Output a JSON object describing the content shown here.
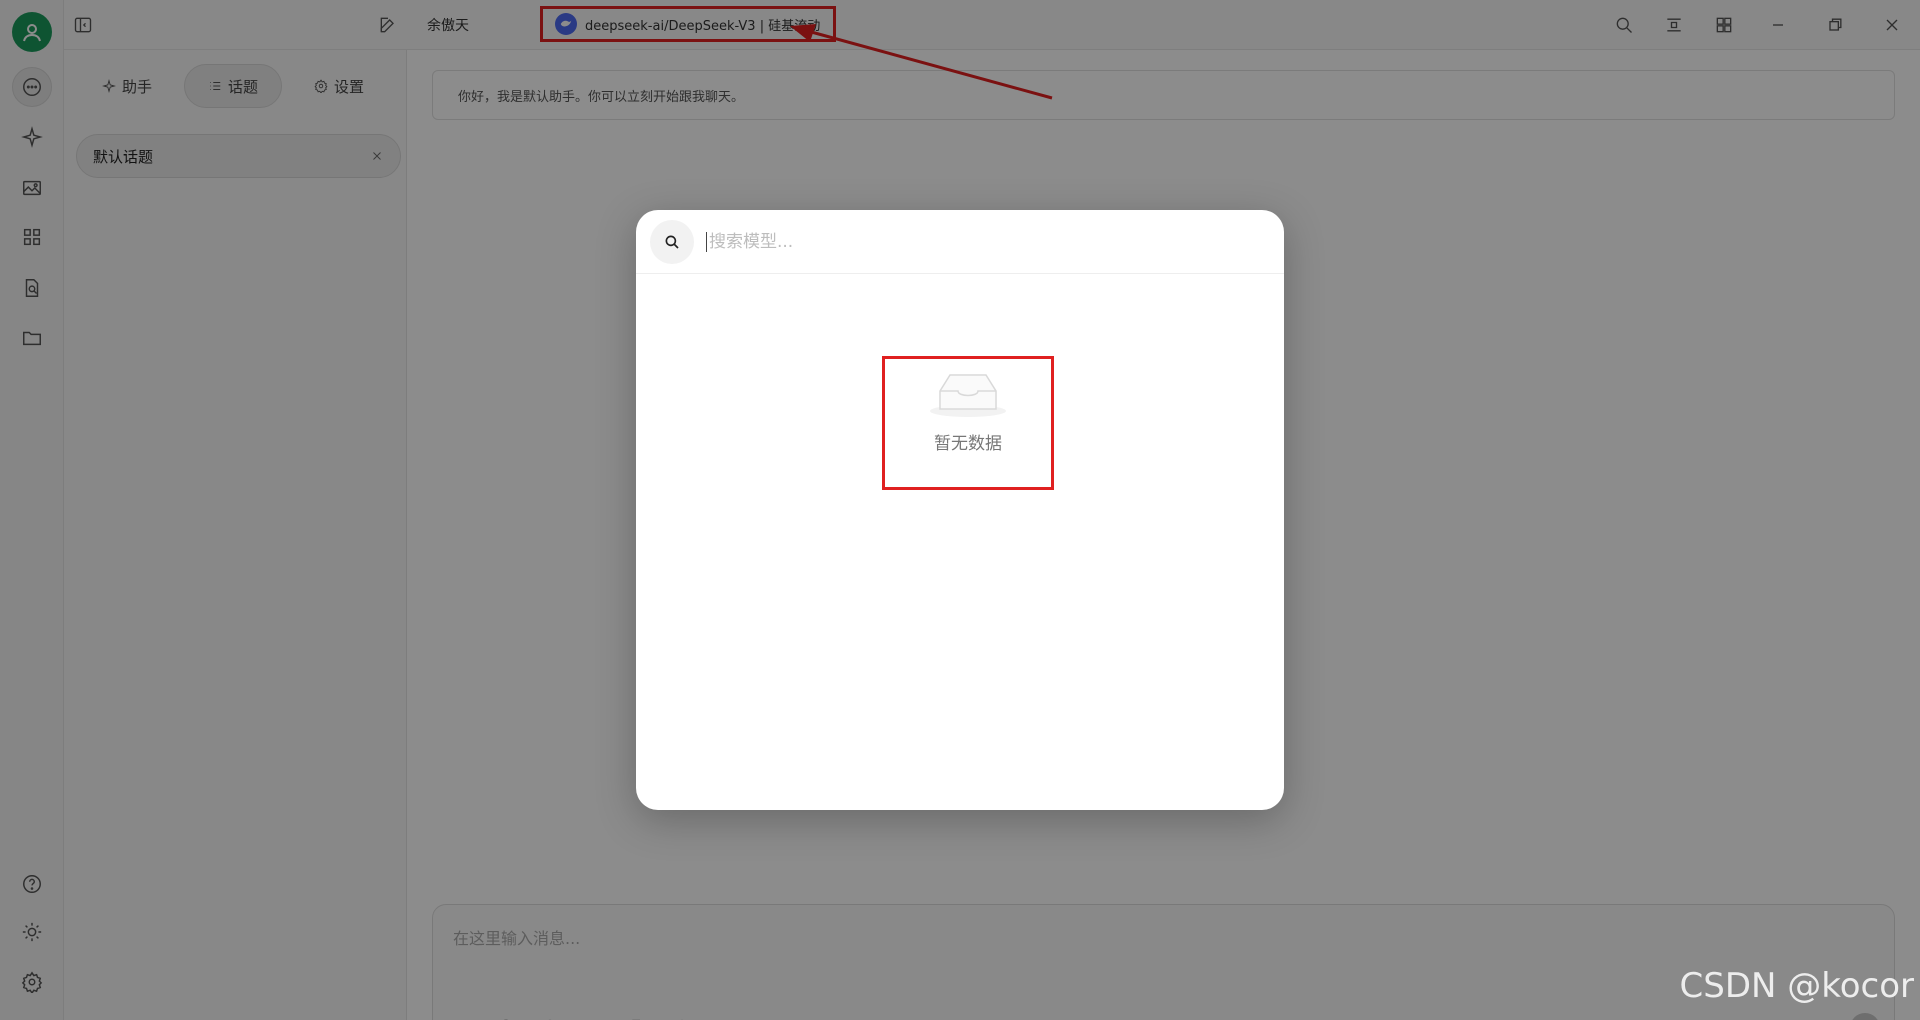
{
  "topbar": {
    "assistant_name": "余傲天",
    "model_label": "deepseek-ai/DeepSeek-V3 | 硅基流动"
  },
  "sidepanel": {
    "tabs": [
      {
        "label": "助手",
        "icon": "sparkle-icon"
      },
      {
        "label": "话题",
        "icon": "list-icon"
      },
      {
        "label": "设置",
        "icon": "gear-icon"
      }
    ],
    "active_tab": "话题",
    "topics": [
      {
        "label": "默认话题"
      }
    ]
  },
  "chat": {
    "welcome_message": "你好，我是默认助手。你可以立刻开始跟我聊天。",
    "composer_placeholder": "在这里输入消息..."
  },
  "model_picker": {
    "search_placeholder": "搜索模型...",
    "empty_text": "暂无数据"
  },
  "watermark": "CSDN @kocor",
  "colors": {
    "accent_green": "#1a9a5c",
    "highlight_red": "#e02020",
    "overlay": "rgba(0,0,0,0.45)"
  }
}
